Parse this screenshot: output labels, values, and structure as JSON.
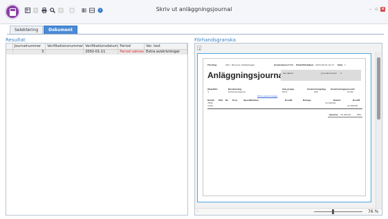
{
  "window": {
    "title": "Skriv ut anläggningsjournal",
    "minimize": "–",
    "maximize": "▫",
    "close": "✕"
  },
  "toolbar": {
    "icons": [
      "calculator-icon",
      "grid-icon",
      "copy-icon",
      "print-icon",
      "search-icon",
      "save-icon",
      "list-icon",
      "barcode-icon",
      "rows-icon",
      "help-icon"
    ]
  },
  "tabs": [
    {
      "label": "Selektering"
    },
    {
      "label": "Dokument"
    }
  ],
  "left": {
    "title": "Resultat",
    "columns": [
      "Journalnummer",
      "Verifikationsnummer",
      "Verifikationsdatum",
      "Period",
      "Ver. text"
    ],
    "rows": [
      {
        "journalnummer": "3",
        "verifikationsnummer": "",
        "verifikationsdatum": "2002-01-11",
        "period": "Period saknas",
        "vertext": "Extra avskrivningar"
      }
    ]
  },
  "right": {
    "title": "Förhandsgranska",
    "page": "1",
    "zoom": "76 %",
    "doc": {
      "title": "Anläggningsjournal",
      "foretag_label": "Företag",
      "foretag": "004 - Personer Aktiebolaget",
      "anvandare_label": "Användare",
      "anvandare": "ADMIN",
      "utskriftsdatum_label": "Utskriftsdatum",
      "utskriftsdatum": "2016-08-16 14:17",
      "sida_label": "Sida",
      "sida": "1",
      "verdatum_label": "Ver.datum",
      "journalnummer_label": "Journalnummer",
      "journalnummer": "3",
      "objekt_label": "Objektnr",
      "objekt": "3",
      "benamning_label": "Benämning",
      "benamning": "Kontorsmaskiner",
      "avgrupp_label": "Avk.grupp",
      "avgrupp": "Tomt",
      "avskrivningstyp_label": "Avskrivningstyp",
      "avskrivningstyp": "K/M",
      "avskrivningsprocent_label": "Avskrivningsprocent",
      "avskrivningsprocent": "20,00",
      "link": "Extra avskrivningar",
      "cols": [
        "Konto",
        "Enh",
        "Rs",
        "Proj",
        "Specifikation",
        "Kredit",
        "Belopp",
        "Debet",
        "Kredit"
      ],
      "konto1": "7832",
      "konto2": "1229",
      "debet_val": "10 000,00",
      "kredit_val": "10 000,00",
      "summa_label": "Summa",
      "summa": "10 000,00",
      "summa_cur": "SEK"
    }
  },
  "colors": {
    "accent": "#3b7fc4",
    "tab_active": "#4a8ad6",
    "app_button": "#8b3fa6",
    "warning_text": "#dd2222"
  }
}
